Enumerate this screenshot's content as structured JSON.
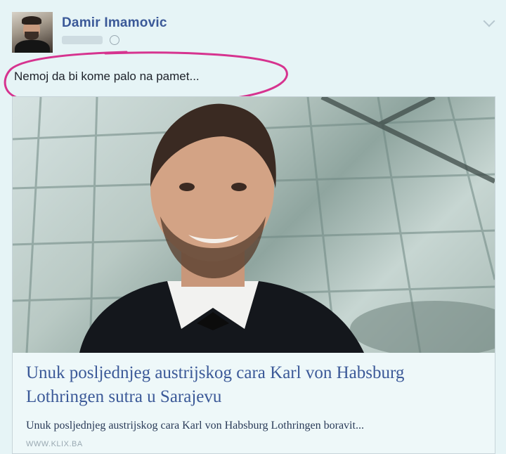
{
  "post": {
    "author": "Damir Imamovic",
    "status_text": "Nemoj da bi kome palo na pamet..."
  },
  "link_card": {
    "headline": "Unuk posljednjeg austrijskog cara Karl von Habsburg Lothringen sutra u Sarajevu",
    "description": "Unuk posljednjeg austrijskog cara Karl von Habsburg Lothringen boravit...",
    "domain": "WWW.KLIX.BA"
  },
  "icons": {
    "privacy": "globe-icon",
    "options": "chevron-down-icon"
  },
  "colors": {
    "background": "#e6f4f6",
    "author_link": "#3b5998",
    "highlight_stroke": "#d6338f"
  }
}
